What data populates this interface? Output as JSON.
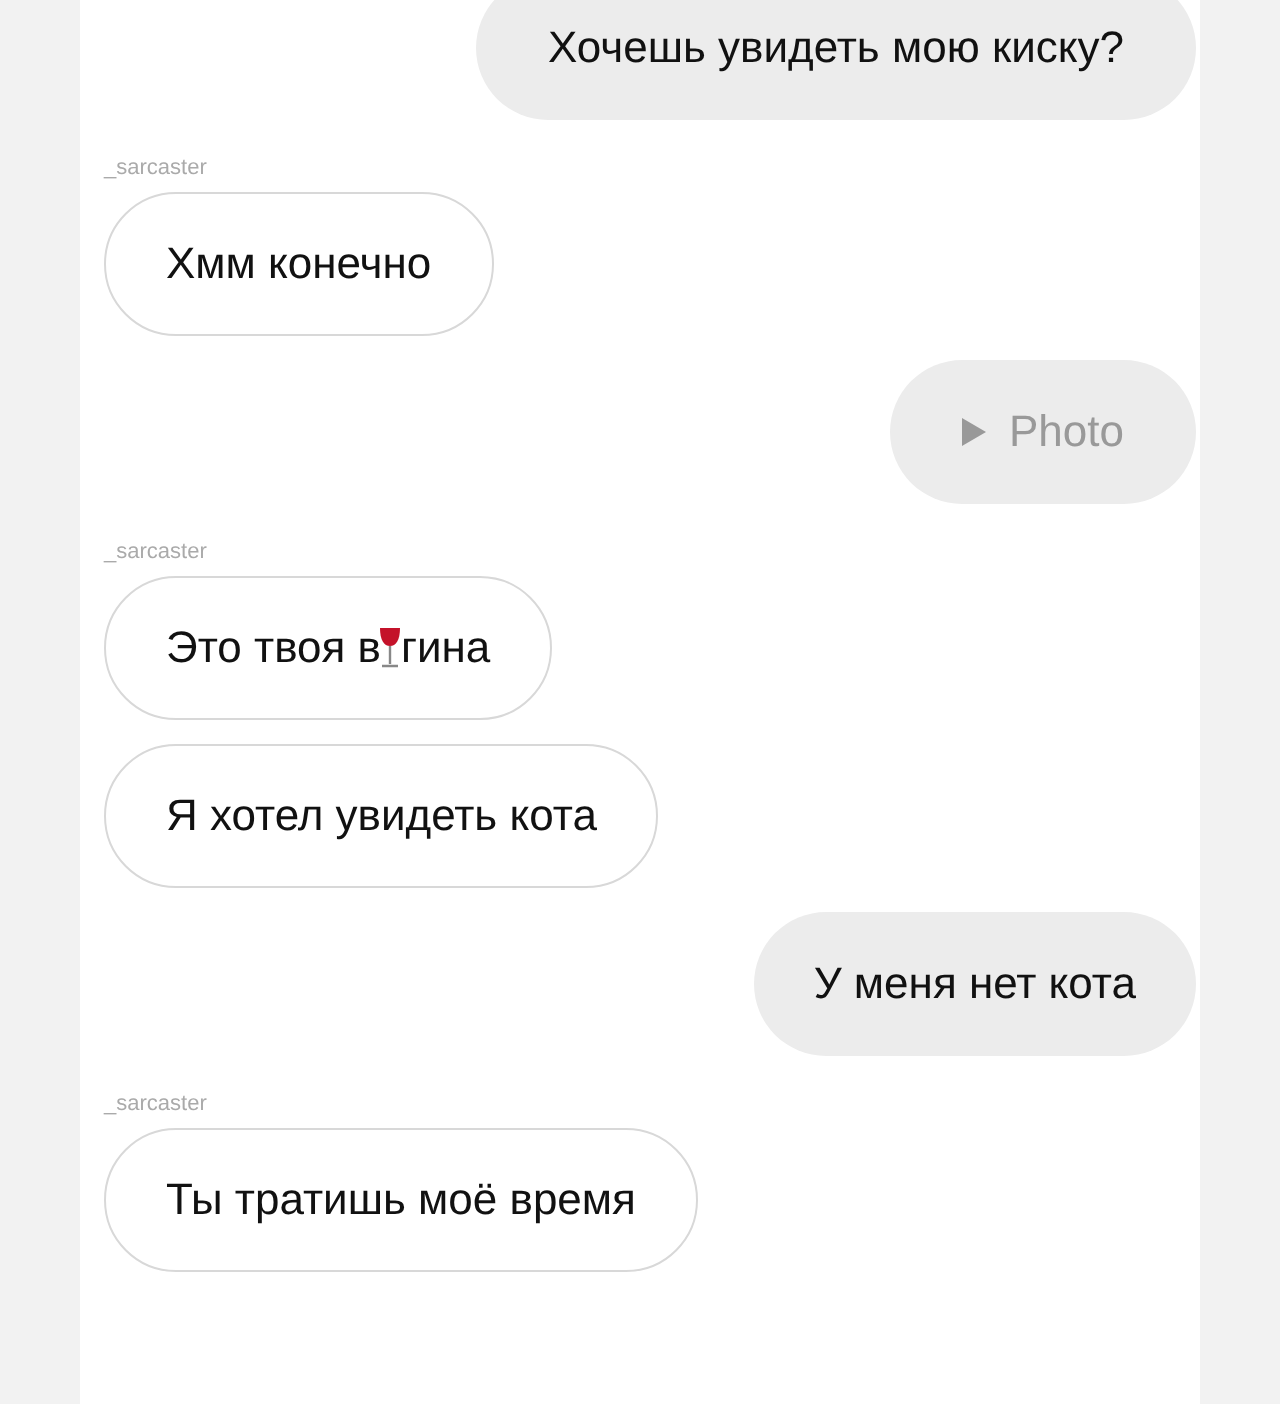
{
  "messages": [
    {
      "kind": "outgoing",
      "text": "Хочешь увидеть мою киску?"
    },
    {
      "kind": "sender",
      "text": "_sarcaster"
    },
    {
      "kind": "incoming",
      "text": "Хмм конечно"
    },
    {
      "kind": "photo",
      "text": "Photo"
    },
    {
      "kind": "sender",
      "text": "_sarcaster"
    },
    {
      "kind": "censored",
      "text_before": "Это твоя в",
      "text_after": "гина"
    },
    {
      "kind": "incoming",
      "text": "Я хотел увидеть кота"
    },
    {
      "kind": "outgoing",
      "text": "У меня нет кота"
    },
    {
      "kind": "sender",
      "text": "_sarcaster"
    },
    {
      "kind": "incoming",
      "text": "Ты тратишь моё время"
    }
  ]
}
